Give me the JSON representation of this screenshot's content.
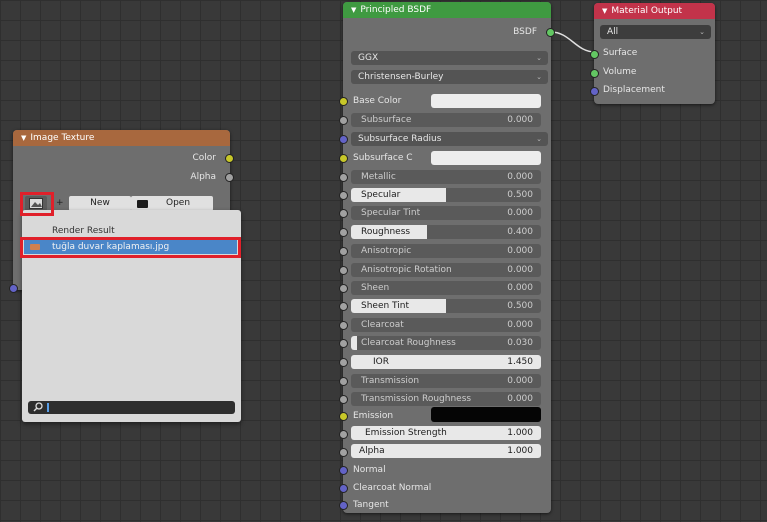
{
  "image_texture": {
    "title": "Image Texture",
    "outputs": [
      "Color",
      "Alpha"
    ],
    "new_label": "New",
    "open_label": "Open",
    "plus": "+"
  },
  "image_browser": {
    "items": [
      "Render Result",
      "tuğla duvar kaplaması.jpg"
    ],
    "search_value": ""
  },
  "principled": {
    "title": "Principled BSDF",
    "output": "BSDF",
    "distribution": "GGX",
    "subsurface_method": "Christensen-Burley",
    "base_color_label": "Base Color",
    "subsurface_color_label": "Subsurface C",
    "emission_label": "Emission",
    "normal_label": "Normal",
    "clearcoat_normal_label": "Clearcoat Normal",
    "tangent_label": "Tangent",
    "subsurface_radius_label": "Subsurface Radius",
    "params": {
      "subsurface": {
        "label": "Subsurface",
        "value": "0.000",
        "fill": 0
      },
      "metallic": {
        "label": "Metallic",
        "value": "0.000",
        "fill": 0
      },
      "specular": {
        "label": "Specular",
        "value": "0.500",
        "fill": 0.5
      },
      "specular_tint": {
        "label": "Specular Tint",
        "value": "0.000",
        "fill": 0
      },
      "roughness": {
        "label": "Roughness",
        "value": "0.400",
        "fill": 0.4
      },
      "anisotropic": {
        "label": "Anisotropic",
        "value": "0.000",
        "fill": 0
      },
      "anisotropic_rotation": {
        "label": "Anisotropic Rotation",
        "value": "0.000",
        "fill": 0
      },
      "sheen": {
        "label": "Sheen",
        "value": "0.000",
        "fill": 0
      },
      "sheen_tint": {
        "label": "Sheen Tint",
        "value": "0.500",
        "fill": 0.5
      },
      "clearcoat": {
        "label": "Clearcoat",
        "value": "0.000",
        "fill": 0
      },
      "clearcoat_roughness": {
        "label": "Clearcoat Roughness",
        "value": "0.030",
        "fill": 0.03
      },
      "ior": {
        "label": "IOR",
        "value": "1.450"
      },
      "transmission": {
        "label": "Transmission",
        "value": "0.000",
        "fill": 0
      },
      "transmission_roughness": {
        "label": "Transmission Roughness",
        "value": "0.000",
        "fill": 0
      },
      "emission_strength": {
        "label": "Emission Strength",
        "value": "1.000"
      },
      "alpha": {
        "label": "Alpha",
        "value": "1.000"
      }
    }
  },
  "material_output": {
    "title": "Material Output",
    "target": "All",
    "inputs": [
      "Surface",
      "Volume",
      "Displacement"
    ]
  },
  "colors": {
    "texture_header": "#a8683e",
    "shader_header": "#3f9a41",
    "output_header": "#c2334a",
    "highlight": "#e0202a",
    "selection": "#4a86c8"
  },
  "icons": {
    "browse_image": "image-browse-icon",
    "open_folder": "folder-icon",
    "search": "search-icon",
    "image_item": "image-file-icon"
  }
}
